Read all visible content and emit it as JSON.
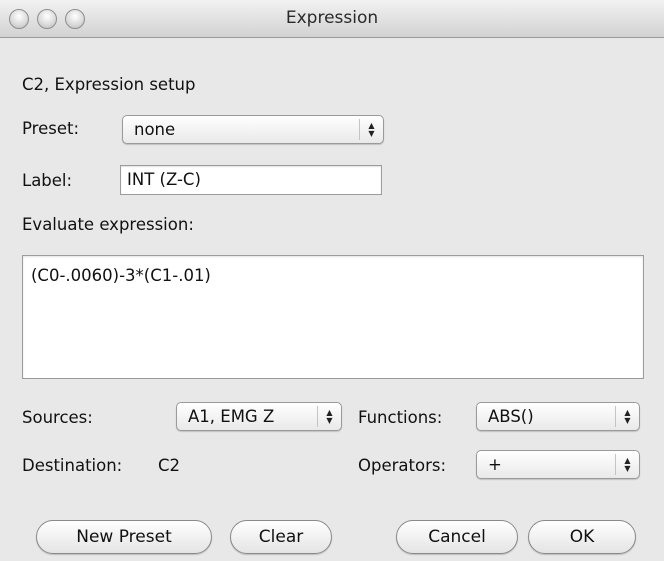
{
  "window": {
    "title": "Expression"
  },
  "setup_heading": "C2, Expression setup",
  "preset": {
    "label": "Preset:",
    "value": "none"
  },
  "label_field": {
    "label": "Label:",
    "value": "INT (Z-C)"
  },
  "evaluate": {
    "label": "Evaluate expression:",
    "value": "(C0-.0060)-3*(C1-.01)"
  },
  "sources": {
    "label": "Sources:",
    "value": "A1, EMG Z"
  },
  "functions": {
    "label": "Functions:",
    "value": "ABS()"
  },
  "destination": {
    "label": "Destination:",
    "value": "C2"
  },
  "operators": {
    "label": "Operators:",
    "value": "+"
  },
  "buttons": {
    "new_preset": "New Preset",
    "clear": "Clear",
    "cancel": "Cancel",
    "ok": "OK"
  },
  "icons": {
    "popup_arrows": "updown-arrows-icon"
  }
}
